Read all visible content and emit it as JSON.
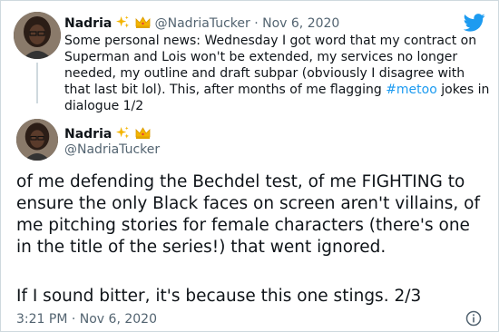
{
  "tweet1": {
    "name": "Nadria",
    "handle_date": "@NadriaTucker · Nov 6, 2020",
    "text_before": "Some personal news: Wednesday I got word that my contract on Superman and Lois won't be extended, my services no longer needed, my outline and draft subpar (obviously I disagree with that last bit lol). This, after months of me flagging ",
    "hashtag": "#metoo",
    "text_after": " jokes in dialogue 1/2"
  },
  "tweet2": {
    "name": "Nadria",
    "handle": "@NadriaTucker",
    "text_para1": "of me defending the Bechdel test, of me FIGHTING to ensure the only Black faces on screen aren't villains, of me pitching stories for female characters (there's one in the title of the series!) that went ignored.",
    "text_para2": "If I sound bitter, it's because this one stings. 2/3",
    "timestamp": "3:21 PM · Nov 6, 2020"
  },
  "icons": {
    "brand": "twitter-bird-icon",
    "sparkles": "sparkles-emoji",
    "crown": "crown-emoji",
    "info": "info-icon"
  },
  "colors": {
    "twitter_blue": "#1d9bf0",
    "text_primary": "#0f1419",
    "text_secondary": "#536471",
    "border": "#cfd9de"
  }
}
